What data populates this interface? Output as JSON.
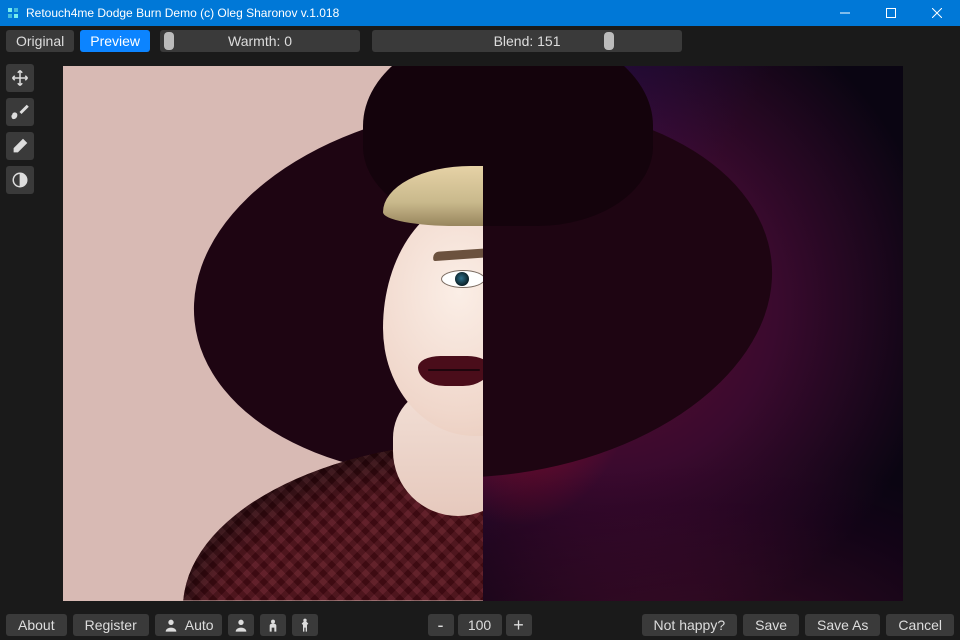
{
  "window": {
    "title": "Retouch4me Dodge Burn Demo (c) Oleg Sharonov v.1.018"
  },
  "toolbar": {
    "original_label": "Original",
    "preview_label": "Preview",
    "active_tab": "Preview",
    "warmth_label": "Warmth: 0",
    "warmth_value": 0,
    "warmth_min": -100,
    "warmth_max": 100,
    "blend_label": "Blend: 151",
    "blend_value": 151,
    "blend_min": 0,
    "blend_max": 200
  },
  "side_tools": [
    {
      "name": "move-tool",
      "icon": "move"
    },
    {
      "name": "brush-tool",
      "icon": "brush"
    },
    {
      "name": "eraser-tool",
      "icon": "eraser"
    },
    {
      "name": "contrast-tool",
      "icon": "circle-half"
    }
  ],
  "zoom": {
    "minus_label": "-",
    "value": "100",
    "plus_label": "+"
  },
  "bottom": {
    "about_label": "About",
    "register_label": "Register",
    "auto_label": "Auto",
    "not_happy_label": "Not happy?",
    "save_label": "Save",
    "save_as_label": "Save As",
    "cancel_label": "Cancel"
  },
  "colors": {
    "accent": "#0078d7",
    "active": "#0c84ff",
    "panel": "#3a3a3a",
    "bg": "#1a1a1a"
  }
}
